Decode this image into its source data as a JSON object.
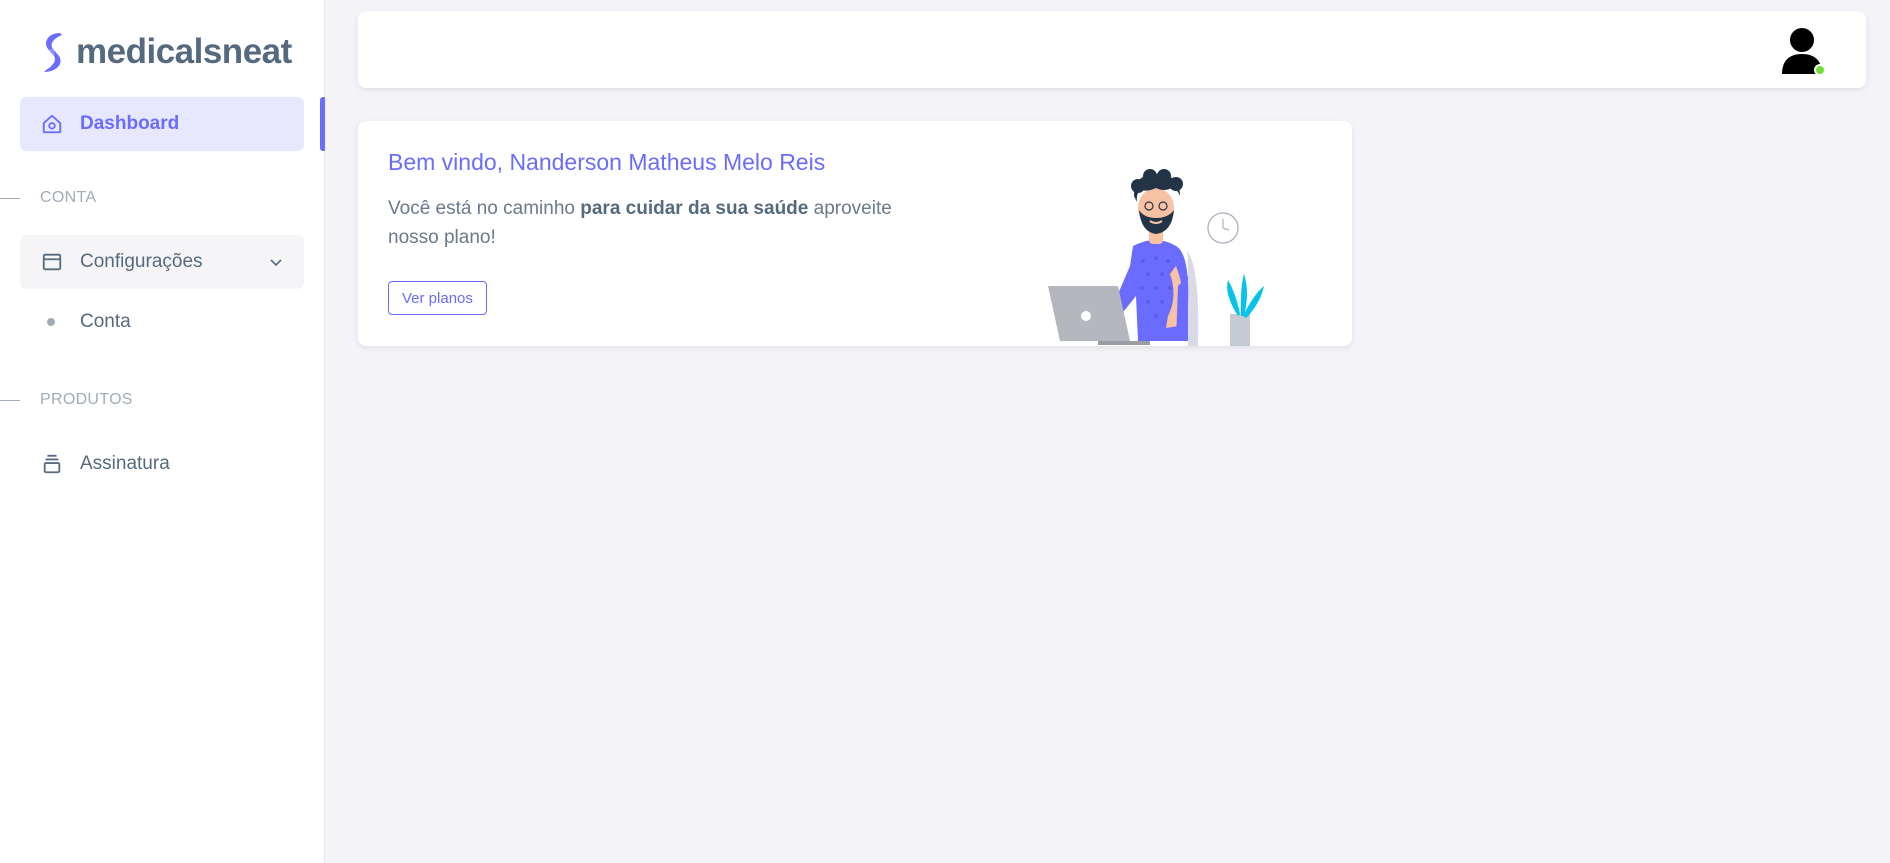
{
  "brand": {
    "name": "medicalsneat",
    "logo_icon": "brand-s-logo-icon"
  },
  "sidebar": {
    "dashboard": {
      "label": "Dashboard",
      "icon": "home-icon"
    },
    "section_conta": "CONTA",
    "configuracoes": {
      "label": "Configurações",
      "icon": "layout-icon",
      "expanded": true
    },
    "sub_items": [
      {
        "label": "Conta"
      }
    ],
    "section_produtos": "PRODUTOS",
    "assinatura": {
      "label": "Assinatura",
      "icon": "stack-icon"
    }
  },
  "topbar": {
    "avatar_icon": "user-avatar-icon",
    "online": true
  },
  "welcome": {
    "title": "Bem vindo, Nanderson Matheus Melo Reis",
    "text_before": "Você está no caminho ",
    "text_bold": "para cuidar da sua saúde",
    "text_after": " aproveite nosso plano!",
    "button": "Ver planos",
    "illustration": "man-with-laptop-illustration"
  },
  "colors": {
    "primary": "#696cff",
    "primary_light": "#e7e7ff",
    "text": "#566a7f",
    "muted": "#a1acb8",
    "online": "#71dd37",
    "background": "#f4f3f8"
  }
}
